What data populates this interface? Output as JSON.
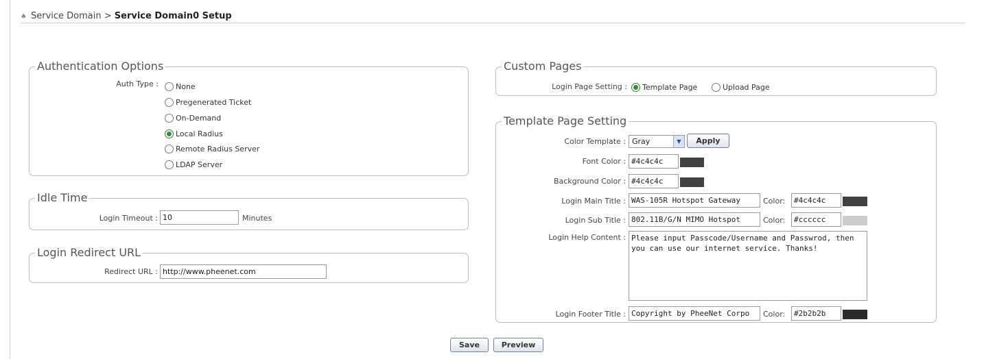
{
  "breadcrumb": {
    "home_icon": "home-icon",
    "section": "Service Domain",
    "separator": ">",
    "current": "Service Domain0 Setup"
  },
  "auth": {
    "legend": "Authentication Options",
    "type_label": "Auth Type :",
    "options": [
      "None",
      "Pregenerated Ticket",
      "On-Demand",
      "Local Radius",
      "Remote Radius Server",
      "LDAP Server"
    ],
    "selected": "Local Radius"
  },
  "idle": {
    "legend": "Idle Time",
    "label": "Login Timeout :",
    "value": "10",
    "unit": "Minutes"
  },
  "redirect": {
    "legend": "Login Redirect URL",
    "label": "Redirect URL :",
    "value": "http://www.pheenet.com"
  },
  "custom": {
    "legend": "Custom Pages",
    "label": "Login Page Setting :",
    "options": [
      "Template Page",
      "Upload Page"
    ],
    "selected": "Template Page"
  },
  "template": {
    "legend": "Template Page Setting",
    "color_template_label": "Color Template :",
    "color_template_value": "Gray",
    "apply_label": "Apply",
    "font_color_label": "Font Color :",
    "font_color_value": "#4c4c4c",
    "bg_color_label": "Background Color :",
    "bg_color_value": "#4c4c4c",
    "main_title_label": "Login Main Title :",
    "main_title_value": "WAS-105R Hotspot Gateway",
    "main_title_color_label": "Color:",
    "main_title_color": "#4c4c4c",
    "sub_title_label": "Login Sub Title :",
    "sub_title_value": "802.11B/G/N MIMO Hotspot",
    "sub_title_color_label": "Color:",
    "sub_title_color": "#cccccc",
    "help_label": "Login Help Content :",
    "help_value": "Please input Passcode/Username and Passwrod, then you can use our internet service. Thanks!",
    "footer_label": "Login Footer Title :",
    "footer_value": "Copyright by PheeNet Corpo",
    "footer_color_label": "Color:",
    "footer_color": "#2b2b2b"
  },
  "actions": {
    "save_label": "Save",
    "preview_label": "Preview"
  }
}
